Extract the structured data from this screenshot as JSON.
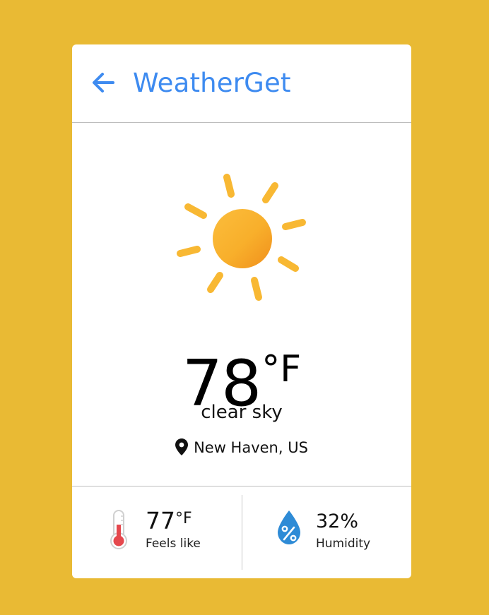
{
  "header": {
    "back_icon": "arrow-left-icon",
    "title": "WeatherGet"
  },
  "colors": {
    "background": "#E9BA34",
    "accent": "#3E8BF0",
    "sun": "#F6A623",
    "thermometer": "#E5484D",
    "drop": "#2E8BD6"
  },
  "current": {
    "icon": "sun-icon",
    "temperature": "78",
    "unit": "°F",
    "description": "clear sky",
    "location_icon": "location-pin-icon",
    "location": "New Haven, US"
  },
  "stats": {
    "feels_like": {
      "icon": "thermometer-icon",
      "value": "77",
      "unit": "°F",
      "label": "Feels like"
    },
    "humidity": {
      "icon": "humidity-drop-icon",
      "value": "32%",
      "label": "Humidity"
    }
  }
}
